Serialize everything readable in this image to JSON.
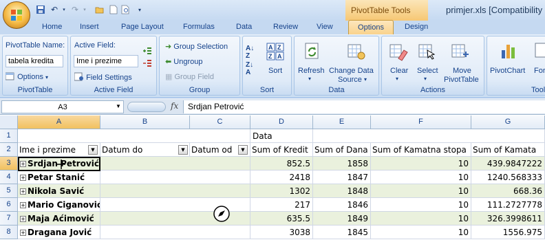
{
  "window": {
    "context_title": "PivotTable Tools",
    "doc_title": "primjer.xls  [Compatibility Mode]"
  },
  "qat": [
    "save-icon",
    "undo-icon",
    "redo-icon",
    "open-icon",
    "new-icon",
    "print-preview-icon",
    "customize-icon"
  ],
  "tabs": [
    "Home",
    "Insert",
    "Page Layout",
    "Formulas",
    "Data",
    "Review",
    "View",
    "Options",
    "Design"
  ],
  "active_tab": "Options",
  "ribbon": {
    "pivottable": {
      "name_label": "PivotTable Name:",
      "name_value": "tabela kredita",
      "options_label": "Options",
      "group_label": "PivotTable"
    },
    "active_field": {
      "label": "Active Field:",
      "value": "Ime i prezime",
      "settings_label": "Field Settings",
      "group_label": "Active Field"
    },
    "group": {
      "group_selection": "Group Selection",
      "ungroup": "Ungroup",
      "group_field": "Group Field",
      "group_label": "Group"
    },
    "sort": {
      "sort_label": "Sort",
      "group_label": "Sort"
    },
    "data": {
      "refresh_label": "Refresh",
      "change_source_line1": "Change Data",
      "change_source_line2": "Source",
      "group_label": "Data"
    },
    "actions": {
      "clear_label": "Clear",
      "select_label": "Select",
      "move_line1": "Move",
      "move_line2": "PivotTable",
      "group_label": "Actions"
    },
    "tools": {
      "pivotchart_label": "PivotChart",
      "formulas_label": "Formulas",
      "group_label": "Tools"
    }
  },
  "formula_bar": {
    "name_box": "A3",
    "fx": "fx",
    "content": "Srdjan Petrović"
  },
  "sheet": {
    "columns": [
      "A",
      "B",
      "C",
      "D",
      "E",
      "F",
      "G"
    ],
    "rows": [
      "1",
      "2",
      "3",
      "4",
      "5",
      "6",
      "7",
      "8"
    ],
    "data_caption": "Data",
    "header_row": {
      "a": "Ime i prezime",
      "b": "Datum do",
      "c": "Datum od",
      "d": "Sum of Kredit",
      "e": "Sum of Dana",
      "f": "Sum of Kamatna stopa",
      "g": "Sum of Kamata"
    },
    "data_rows": [
      {
        "name": "Srdjan Petrović",
        "kredit": "852.5",
        "dana": "1858",
        "stopa": "10",
        "kamata": "439.9847222"
      },
      {
        "name": "Petar Stanić",
        "kredit": "2418",
        "dana": "1847",
        "stopa": "10",
        "kamata": "1240.568333"
      },
      {
        "name": "Nikola Savić",
        "kredit": "1302",
        "dana": "1848",
        "stopa": "10",
        "kamata": "668.36"
      },
      {
        "name": "Mario Ciganović",
        "kredit": "217",
        "dana": "1846",
        "stopa": "10",
        "kamata": "111.2727778"
      },
      {
        "name": "Maja Aćimović",
        "kredit": "635.5",
        "dana": "1849",
        "stopa": "10",
        "kamata": "326.3998611"
      },
      {
        "name": "Dragana Jović",
        "kredit": "3038",
        "dana": "1845",
        "stopa": "10",
        "kamata": "1556.975"
      }
    ]
  },
  "colors": {
    "band": "#eaf1dd",
    "ribbon_bg": "#dbe7f5",
    "context_tab": "#f9d28a",
    "accent_text": "#15428b"
  }
}
